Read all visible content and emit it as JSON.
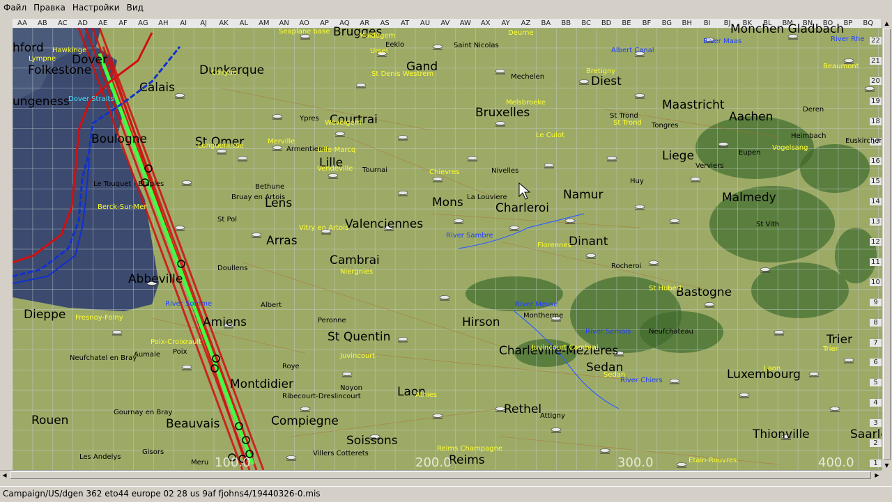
{
  "menu": [
    "Файл",
    "Правка",
    "Настройки",
    "Вид"
  ],
  "status_text": "Campaign/US/dgen  362  eto44  europe  02  28  us  9af  fjohns4/19440326-0.mis",
  "columns": [
    "AA",
    "AB",
    "AC",
    "AD",
    "AE",
    "AF",
    "AG",
    "AH",
    "AI",
    "AJ",
    "AK",
    "AL",
    "AM",
    "AN",
    "AO",
    "AP",
    "AQ",
    "AR",
    "AS",
    "AT",
    "AU",
    "AV",
    "AW",
    "AX",
    "AY",
    "AZ",
    "BA",
    "BB",
    "BC",
    "BD",
    "BE",
    "BF",
    "BG",
    "BH",
    "BI",
    "BJ",
    "BK",
    "BL",
    "BM",
    "BN",
    "BO",
    "BP",
    "BQ"
  ],
  "rows": [
    "22",
    "21",
    "20",
    "19",
    "18",
    "17",
    "16",
    "15",
    "14",
    "13",
    "12",
    "11",
    "10",
    "9",
    "8",
    "7",
    "6",
    "5",
    "4",
    "3",
    "2",
    "1"
  ],
  "scale_labels": [
    "100.0",
    "200.0",
    "300.0",
    "400.0"
  ],
  "cities": [
    "Brugges",
    "Gand",
    "Dunkerque",
    "Calais",
    "Folkestone",
    "Dover",
    "ungeness",
    "Boulogne",
    "St Omer",
    "Lille",
    "Courtrai",
    "Bruxelles",
    "Diest",
    "Maastricht",
    "Aachen",
    "Liege",
    "Namur",
    "Charleroi",
    "Mons",
    "Valenciennes",
    "Lens",
    "Arras",
    "Cambrai",
    "Malmedy",
    "Dinant",
    "Bastogne",
    "Abbeville",
    "Dieppe",
    "Amiens",
    "St  Quentin",
    "Hirson",
    "Charleville-Mezieres",
    "Sedan",
    "Montdidier",
    "Laon",
    "Rethel",
    "Luxembourg",
    "Trier",
    "Beauvais",
    "Compiegne",
    "Soissons",
    "Reims",
    "Rouen",
    "Thionville",
    "Saarlo",
    "Monchen Gladbach",
    "hford"
  ],
  "towns": [
    "Eeklo",
    "Saint Nicolas",
    "Mechelen",
    "Ypres",
    "Tongres",
    "Deren",
    "Heimbach",
    "Euskirchen",
    "Eupen",
    "Verviers",
    "Huy",
    "Nivelles",
    "La Louviere",
    "Bethune",
    "Armentieres",
    "Tournai",
    "Bruay en Artois",
    "St Pol",
    "Doullens",
    "Albert",
    "Peronne",
    "Roye",
    "Noyon",
    "Ribecourt-Dreslincourt",
    "Gournay en Bray",
    "Aumale",
    "Poix",
    "Neufchatel en Bray",
    "Gisors",
    "Les Andelys",
    "Meru",
    "Villers Cotterets",
    "Attigny",
    "Rocheroi",
    "Montherme",
    "Neufchateau",
    "St Vith",
    "Le Touquet - Etaples",
    "St Trond",
    "Albert Canal"
  ],
  "airfields": [
    "Seaplane base",
    "Maldegem",
    "Ursel",
    "St Denis Westrem",
    "Deurne",
    "St Trond",
    "Melsbroeke",
    "Le Culot",
    "Vitry en Artois",
    "Vendeville",
    "Lille-Marcq",
    "Wevelgem",
    "Merville",
    "Longuenesse",
    "Chievres",
    "Florennes",
    "Niergnies",
    "Fresnoy-Folny",
    "Poix-Croixrault",
    "Juvincourt",
    "Athies",
    "Laon",
    "Reims Champagne",
    "Etain-Rouvres",
    "Vogelsang",
    "St Hubert",
    "Lympne",
    "Hawkinge",
    "Coxyde",
    "Beaumont",
    "Bretigny",
    "Sedan",
    "Trier",
    "Juvincourt Cambrai",
    "Berck-Sur-Mer"
  ],
  "rivers": [
    "River  Maas",
    "River  Sambre",
    "River  Meuse",
    "River  Somme",
    "River  Semois",
    "River  Chiers",
    "River Rhe"
  ],
  "sea_labels": [
    "Dover Straits"
  ],
  "colors": {
    "sea": "#3b4a6e",
    "land": "#9caa66",
    "forest": "#3f6b2e",
    "grid": "#c8d0d8",
    "route_red": "#d01010",
    "route_green": "#40ff40",
    "route_blue": "#1030d0"
  }
}
